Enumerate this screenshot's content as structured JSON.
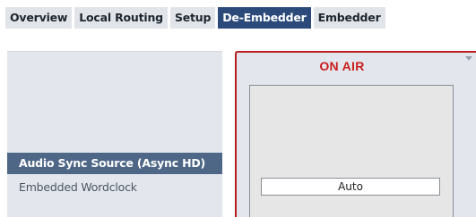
{
  "tabs": [
    {
      "label": "Overview"
    },
    {
      "label": "Local Routing"
    },
    {
      "label": "Setup"
    },
    {
      "label": "De-Embedder"
    },
    {
      "label": "Embedder"
    }
  ],
  "active_tab": "De-Embedder",
  "sync_sources": [
    {
      "label": "Audio Sync Source (Async HD)"
    },
    {
      "label": "Embedded Wordclock"
    }
  ],
  "selected_source": "Audio Sync Source (Async HD)",
  "status": {
    "label": "ON AIR",
    "color": "#c81e1e"
  },
  "control": {
    "value": "Auto"
  },
  "colors": {
    "active_tab": "#2b4a7a",
    "selected_item": "#4e6786",
    "on_air_border": "#b81e1e"
  }
}
